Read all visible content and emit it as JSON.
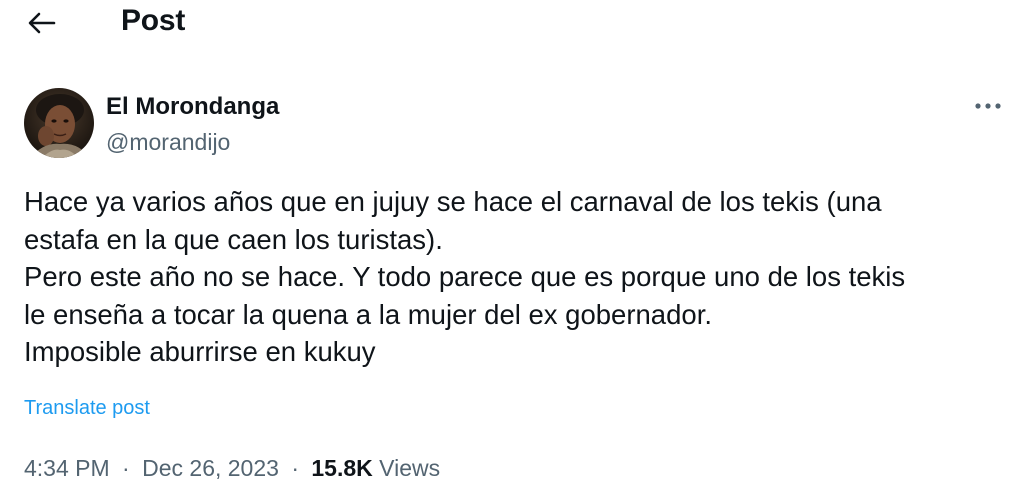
{
  "header": {
    "title": "Post"
  },
  "icons": {
    "back": "arrow-left-icon",
    "more": "more-horizontal-icon"
  },
  "author": {
    "name": "El Morondanga",
    "handle": "@morandijo"
  },
  "post": {
    "lines": [
      "Hace ya varios años que en jujuy se hace el carnaval de los tekis (una",
      "estafa en la que caen los turistas).",
      "Pero este año no se hace. Y todo parece que es porque uno de los tekis",
      "le enseña a tocar la quena a la mujer del ex gobernador.",
      "Imposible aburrirse en kukuy"
    ],
    "translate_label": "Translate post"
  },
  "meta": {
    "time": "4:34 PM",
    "separator": "·",
    "date": "Dec 26, 2023",
    "views_count": "15.8K",
    "views_label": "Views"
  },
  "colors": {
    "text_primary": "#0f1419",
    "text_secondary": "#536471",
    "link": "#1d9bf0"
  }
}
